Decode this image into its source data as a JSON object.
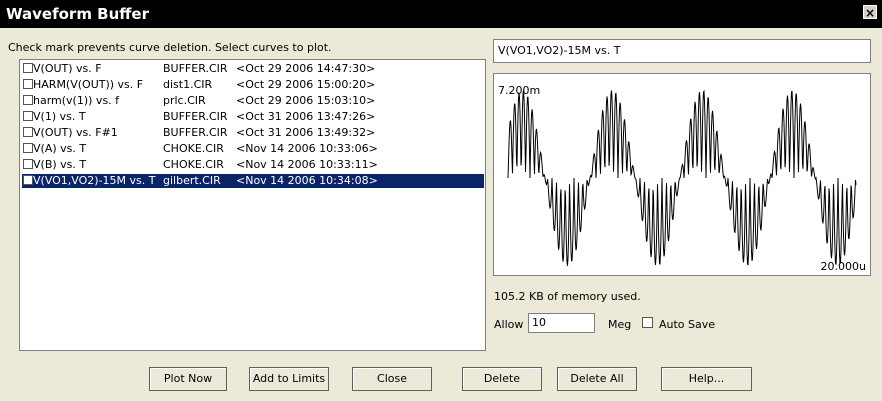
{
  "window": {
    "title": "Waveform Buffer",
    "close_glyph": "×"
  },
  "hint": "Check mark prevents curve deletion. Select curves to plot.",
  "curves": [
    {
      "name": "V(OUT) vs. F",
      "file": "BUFFER.CIR",
      "date": "<Oct 29 2006 14:47:30>"
    },
    {
      "name": "HARM(V(OUT)) vs. F",
      "file": "dist1.CIR",
      "date": "<Oct 29 2006 15:00:20>"
    },
    {
      "name": "harm(v(1)) vs. f",
      "file": "prlc.CIR",
      "date": "<Oct 29 2006 15:03:10>"
    },
    {
      "name": "V(1) vs. T",
      "file": "BUFFER.CIR",
      "date": "<Oct 31 2006 13:47:26>"
    },
    {
      "name": "V(OUT) vs. F#1",
      "file": "BUFFER.CIR",
      "date": "<Oct 31 2006 13:49:32>"
    },
    {
      "name": "V(A) vs. T",
      "file": "CHOKE.CIR",
      "date": "<Nov 14 2006 10:33:06>"
    },
    {
      "name": "V(B) vs. T",
      "file": "CHOKE.CIR",
      "date": "<Nov 14 2006 10:33:11>"
    },
    {
      "name": "V(VO1,VO2)-15M vs. T",
      "file": "gilbert.CIR",
      "date": "<Nov 14 2006 10:34:08>",
      "selected": true
    }
  ],
  "preview": {
    "curve_name": "V(VO1,VO2)-15M vs. T",
    "y_max_label": "7.200m",
    "x_max_label": "20.000u"
  },
  "memory_text": "105.2 KB of memory used.",
  "allow": {
    "label": "Allow",
    "value": "10",
    "unit": "Meg"
  },
  "auto_save": {
    "label": "Auto Save",
    "checked": false
  },
  "buttons": {
    "plot_now": "Plot Now",
    "add_to_limits": "Add to Limits",
    "close": "Close",
    "delete": "Delete",
    "delete_all": "Delete All",
    "help": "Help..."
  },
  "colors": {
    "selection": "#0a246a",
    "background": "#ece9d8",
    "titlebar": "#000000"
  }
}
